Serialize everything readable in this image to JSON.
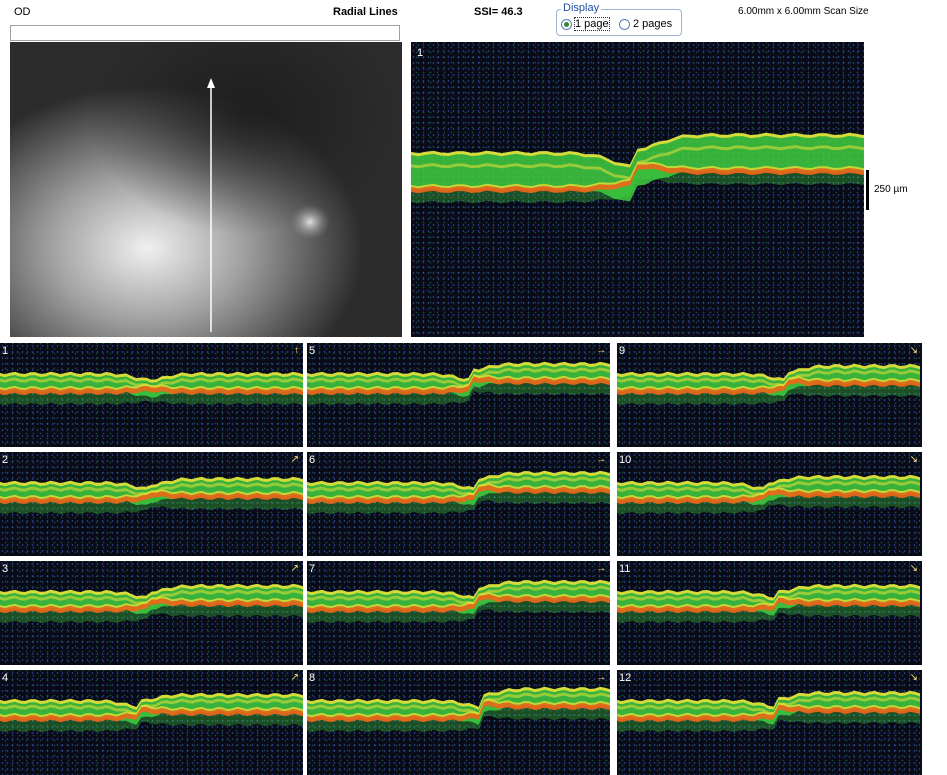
{
  "header": {
    "eye": "OD",
    "scan_type": "Radial Lines",
    "ssi": "SSI= 46.3",
    "scan_size": "6.00mm x 6.00mm Scan Size"
  },
  "display": {
    "legend": "Display",
    "options": [
      {
        "label": "1 page",
        "selected": true
      },
      {
        "label": "2 pages",
        "selected": false
      }
    ]
  },
  "main_scan": {
    "number": "1"
  },
  "scale": {
    "label": "250 µm"
  },
  "thumbnails": [
    {
      "number": "1",
      "icon": "arrow-up-icon"
    },
    {
      "number": "2",
      "icon": "arrow-up-right-icon"
    },
    {
      "number": "3",
      "icon": "arrow-up-right-icon"
    },
    {
      "number": "4",
      "icon": "arrow-up-right-icon"
    },
    {
      "number": "5",
      "icon": "arrow-right-icon"
    },
    {
      "number": "6",
      "icon": "arrow-right-icon"
    },
    {
      "number": "7",
      "icon": "arrow-right-icon"
    },
    {
      "number": "8",
      "icon": "arrow-right-icon"
    },
    {
      "number": "9",
      "icon": "arrow-down-right-icon"
    },
    {
      "number": "10",
      "icon": "arrow-down-right-icon"
    },
    {
      "number": "11",
      "icon": "arrow-down-right-icon"
    },
    {
      "number": "12",
      "icon": "arrow-down-right-icon"
    }
  ],
  "colors": {
    "retina_green": "#3fcf3f",
    "retina_yellow": "#e8e03a",
    "rpe_orange": "#e86a1a",
    "background": "#0a0b18"
  }
}
